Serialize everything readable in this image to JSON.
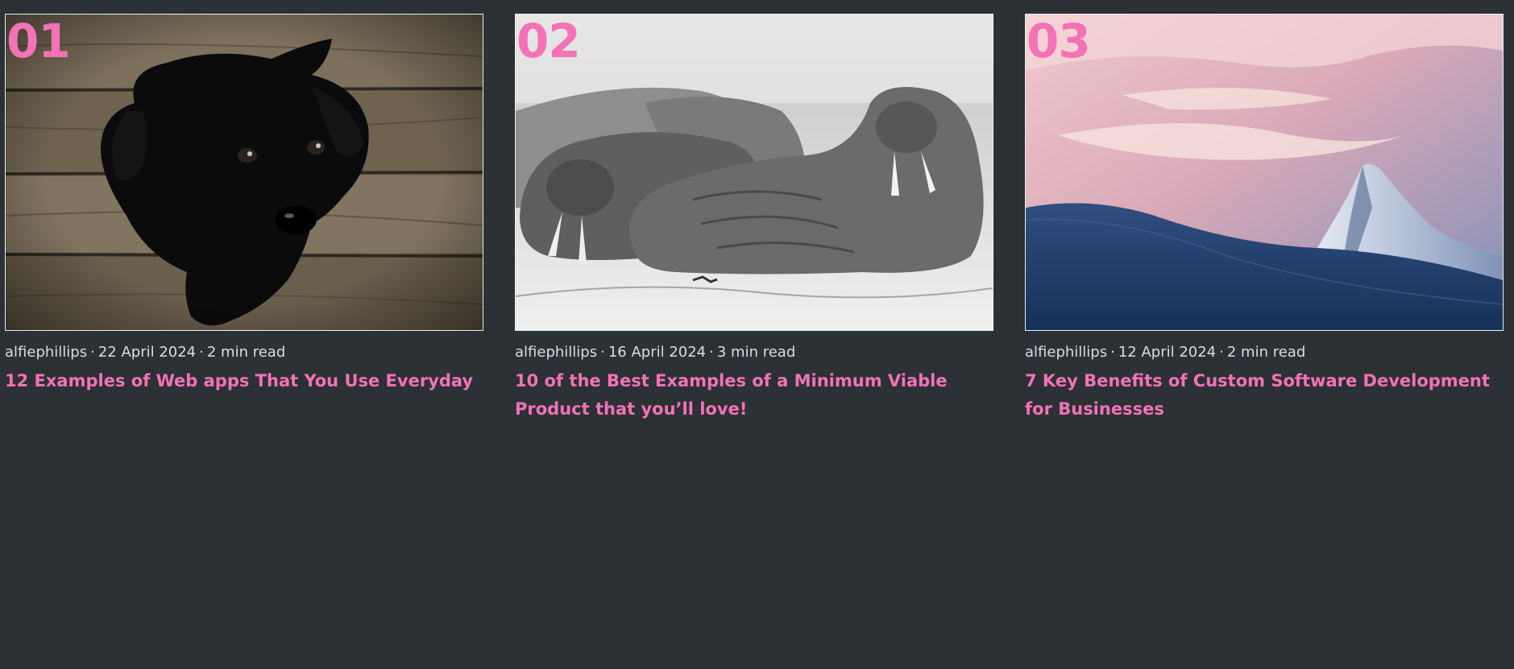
{
  "accent_color": "#f472b6",
  "background_color": "#2b3135",
  "posts": [
    {
      "number": "01",
      "image": "black-puppy-on-wooden-floor",
      "author": "alfiephillips",
      "date": "22 April 2024",
      "read_time": "2 min read",
      "title": "12 Examples of Web apps That You Use Everyday"
    },
    {
      "number": "02",
      "image": "walruses-on-beach-black-and-white",
      "author": "alfiephillips",
      "date": "16 April 2024",
      "read_time": "3 min read",
      "title": "10 of the Best Examples of a Minimum Viable Product that you’ll love!"
    },
    {
      "number": "03",
      "image": "snowy-mountain-peak-at-dusk",
      "author": "alfiephillips",
      "date": "12 April 2024",
      "read_time": "2 min read",
      "title": "7 Key Benefits of Custom Software Development for Businesses"
    }
  ]
}
